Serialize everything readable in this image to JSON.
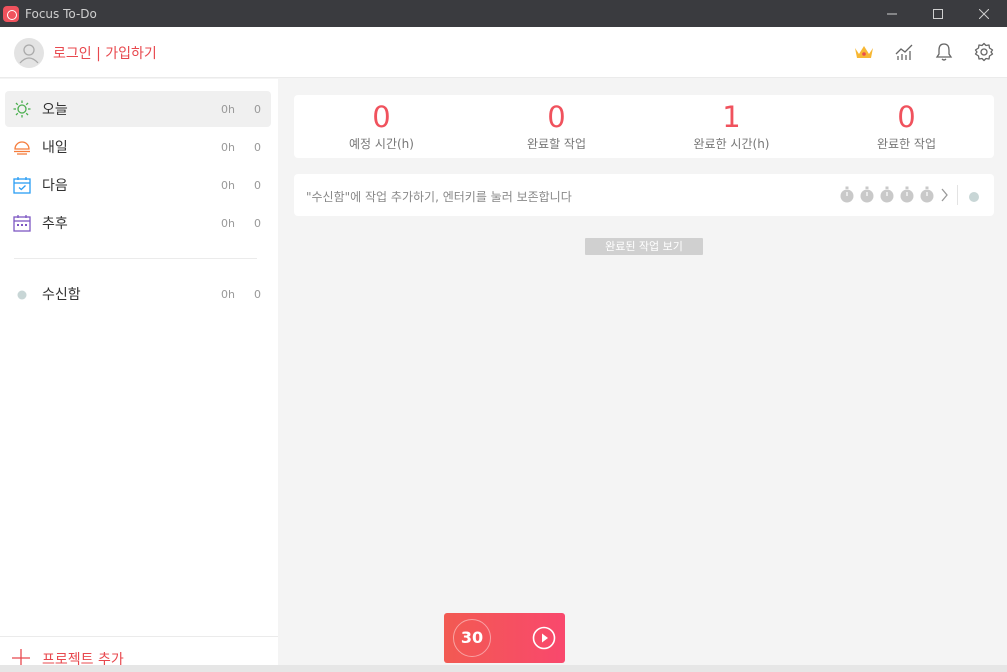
{
  "window": {
    "title": "Focus To-Do"
  },
  "header": {
    "login_text": "로그인 | 가입하기"
  },
  "sidebar": {
    "items": [
      {
        "label": "오늘",
        "time": "0h",
        "count": "0"
      },
      {
        "label": "내일",
        "time": "0h",
        "count": "0"
      },
      {
        "label": "다음",
        "time": "0h",
        "count": "0"
      },
      {
        "label": "추후",
        "time": "0h",
        "count": "0"
      }
    ],
    "projects": [
      {
        "label": "수신함",
        "time": "0h",
        "count": "0"
      }
    ],
    "add_project_label": "프로젝트 추가"
  },
  "stats": [
    {
      "value": "0",
      "label": "예정 시간(h)"
    },
    {
      "value": "0",
      "label": "완료할 작업"
    },
    {
      "value": "1",
      "label": "완료한 시간(h)"
    },
    {
      "value": "0",
      "label": "완료한 작업"
    }
  ],
  "add_task": {
    "placeholder": "\"수신함\"에 작업 추가하기, 엔터키를 눌러 보존합니다"
  },
  "show_completed_label": "완료된 작업 보기",
  "timer": {
    "minutes": "30"
  },
  "colors": {
    "accent": "#f0525d",
    "today": "#4caf50",
    "tomorrow": "#f57c3b",
    "upcoming": "#2a9df4",
    "someday": "#7e57c2"
  }
}
